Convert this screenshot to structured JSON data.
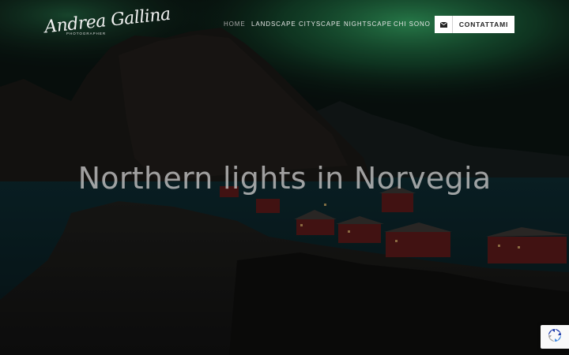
{
  "brand": {
    "name": "Andrea Gallina",
    "tagline": "PHOTOGRAPHER"
  },
  "nav": {
    "items": [
      {
        "label": "HOME",
        "active": true
      },
      {
        "label": "LANDSCAPE",
        "active": false
      },
      {
        "label": "CITYSCAPE",
        "active": false
      },
      {
        "label": "NIGHTSCAPE",
        "active": false
      },
      {
        "label": "CHI SONO",
        "active": false
      }
    ],
    "contact_label": "CONTATTAMI",
    "contact_icon": "envelope-icon"
  },
  "hero": {
    "title": "Northern lights in Norvegia"
  },
  "recaptcha": {
    "icon": "recaptcha-icon"
  },
  "colors": {
    "aurora": "#2fb86a",
    "sky": "#0a1712",
    "button_bg": "#ffffff"
  }
}
